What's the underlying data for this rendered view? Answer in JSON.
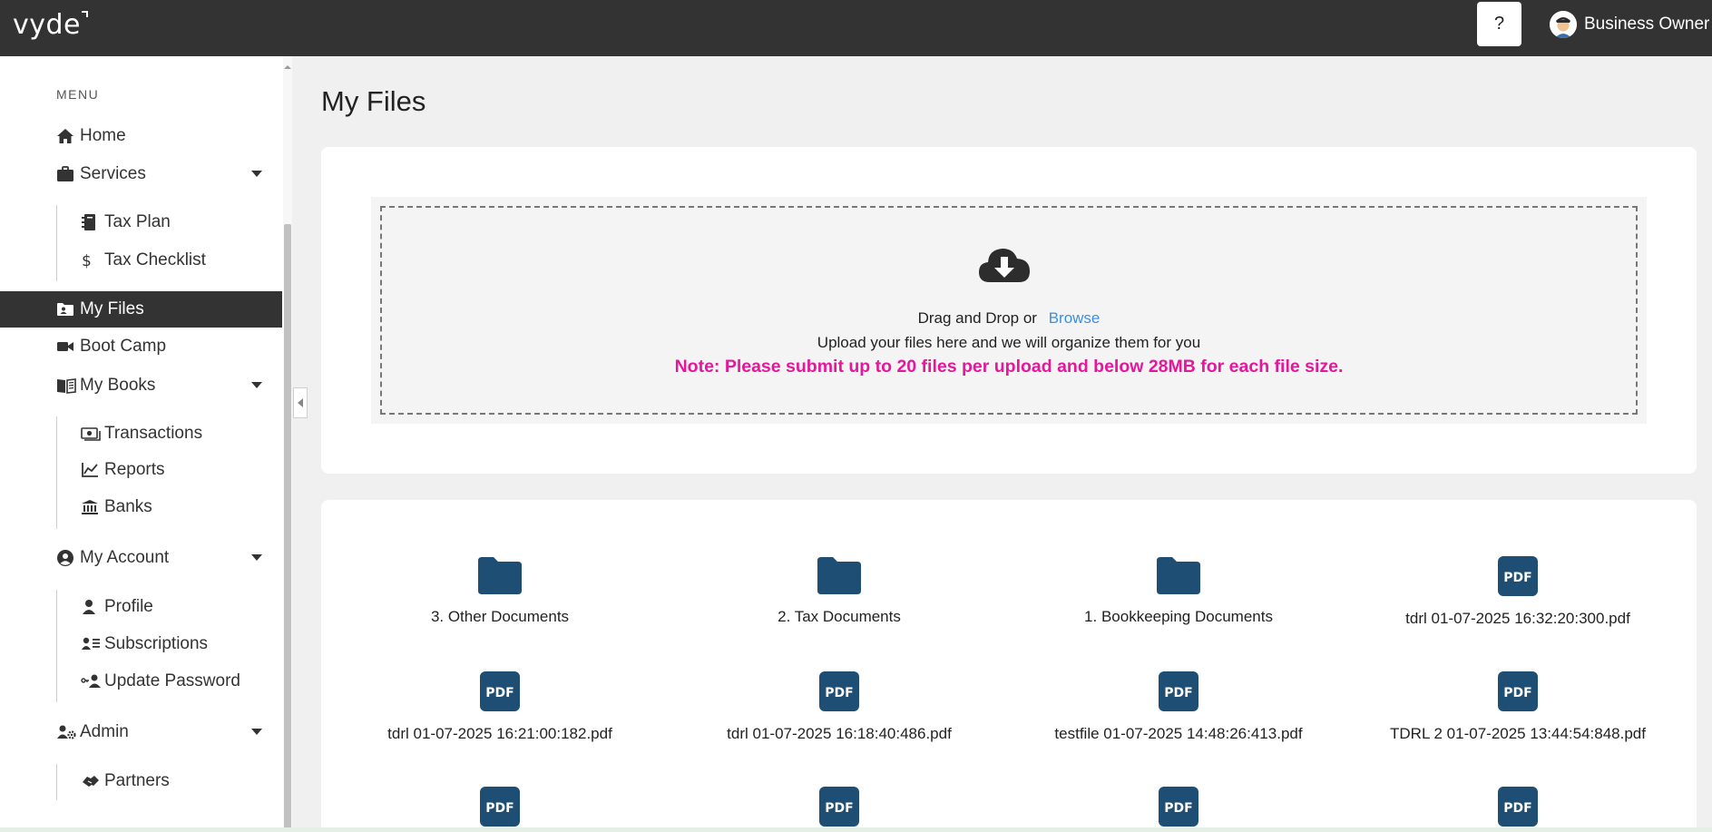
{
  "header": {
    "logo": "vyde",
    "help_label": "?",
    "user_name": "Business Owner"
  },
  "sidebar": {
    "menu_label": "MENU",
    "items": {
      "home": "Home",
      "services": "Services",
      "tax_plan": "Tax Plan",
      "tax_checklist": "Tax Checklist",
      "my_files": "My Files",
      "boot_camp": "Boot Camp",
      "my_books": "My Books",
      "transactions": "Transactions",
      "reports": "Reports",
      "banks": "Banks",
      "my_account": "My Account",
      "profile": "Profile",
      "subscriptions": "Subscriptions",
      "update_password": "Update Password",
      "admin": "Admin",
      "partners": "Partners"
    },
    "active": "my_files"
  },
  "main": {
    "title": "My Files",
    "upload": {
      "drag_text": "Drag and Drop or",
      "browse_label": "Browse",
      "subtitle": "Upload your files here and we will organize them for you",
      "note": "Note: Please submit up to 20 files per upload and below 28MB for each file size."
    },
    "files": [
      {
        "type": "folder",
        "name": "3. Other Documents"
      },
      {
        "type": "folder",
        "name": "2. Tax Documents"
      },
      {
        "type": "folder",
        "name": "1. Bookkeeping Documents"
      },
      {
        "type": "pdf",
        "name": "tdrl 01-07-2025 16:32:20:300.pdf"
      },
      {
        "type": "pdf",
        "name": "tdrl 01-07-2025 16:21:00:182.pdf"
      },
      {
        "type": "pdf",
        "name": "tdrl 01-07-2025 16:18:40:486.pdf"
      },
      {
        "type": "pdf",
        "name": "testfile 01-07-2025 14:48:26:413.pdf"
      },
      {
        "type": "pdf",
        "name": "TDRL 2 01-07-2025 13:44:54:848.pdf"
      },
      {
        "type": "pdf",
        "name": ""
      },
      {
        "type": "pdf",
        "name": ""
      },
      {
        "type": "pdf",
        "name": ""
      },
      {
        "type": "pdf",
        "name": ""
      }
    ],
    "pdf_icon_label": "PDF"
  },
  "colors": {
    "topbar": "#333333",
    "active_nav": "#333333",
    "file_icon": "#1f4e74",
    "browse_link": "#3d8fe0",
    "note": "#e5179a"
  }
}
